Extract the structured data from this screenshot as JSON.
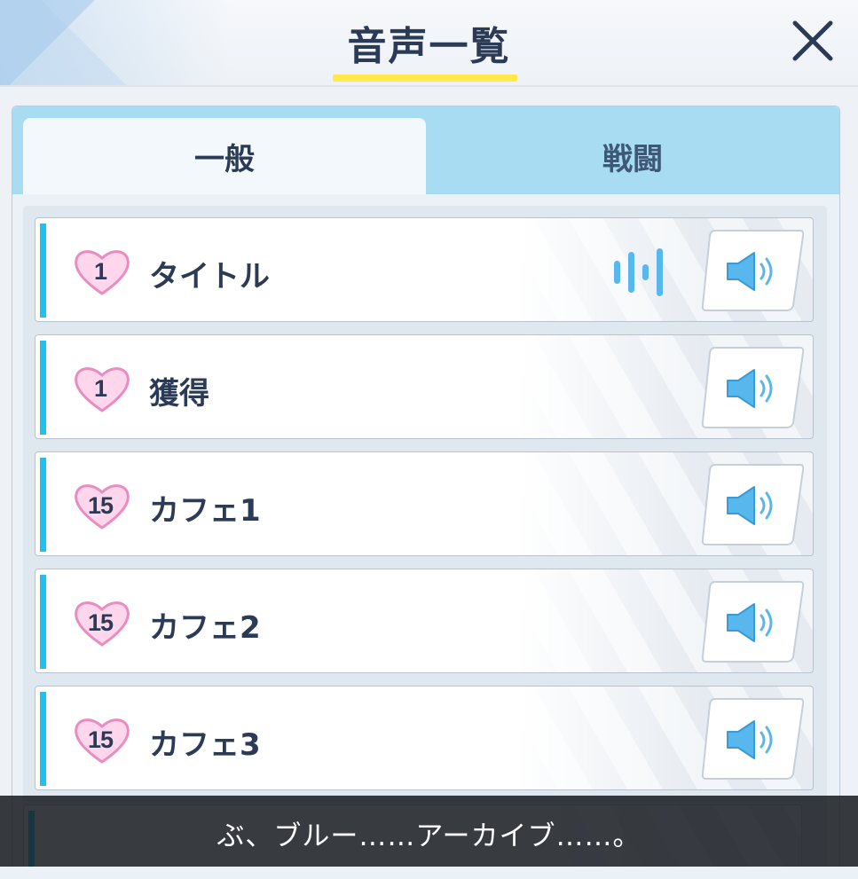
{
  "header": {
    "title": "音声一覧",
    "close_icon": "close-icon"
  },
  "tabs": [
    {
      "label": "一般",
      "selected": true
    },
    {
      "label": "戦闘",
      "selected": false
    }
  ],
  "voices": [
    {
      "level": "1",
      "label": "タイトル",
      "playing": true
    },
    {
      "level": "1",
      "label": "獲得",
      "playing": false
    },
    {
      "level": "15",
      "label": "カフェ1",
      "playing": false
    },
    {
      "level": "15",
      "label": "カフェ2",
      "playing": false
    },
    {
      "level": "15",
      "label": "カフェ3",
      "playing": false
    }
  ],
  "subtitle": "ぶ、ブルー……アーカイブ……。",
  "colors": {
    "accent": "#1fc2ee",
    "title_text": "#2b3a55",
    "underline": "#ffe94a",
    "tab_bar": "#a8dcf2",
    "heart_fill": "#ffd6ec",
    "heart_stroke": "#e98cc0",
    "speaker": "#58b7ec"
  },
  "icons": {
    "heart": "heart-icon",
    "speaker": "speaker-icon",
    "waveform": "waveform-icon"
  }
}
